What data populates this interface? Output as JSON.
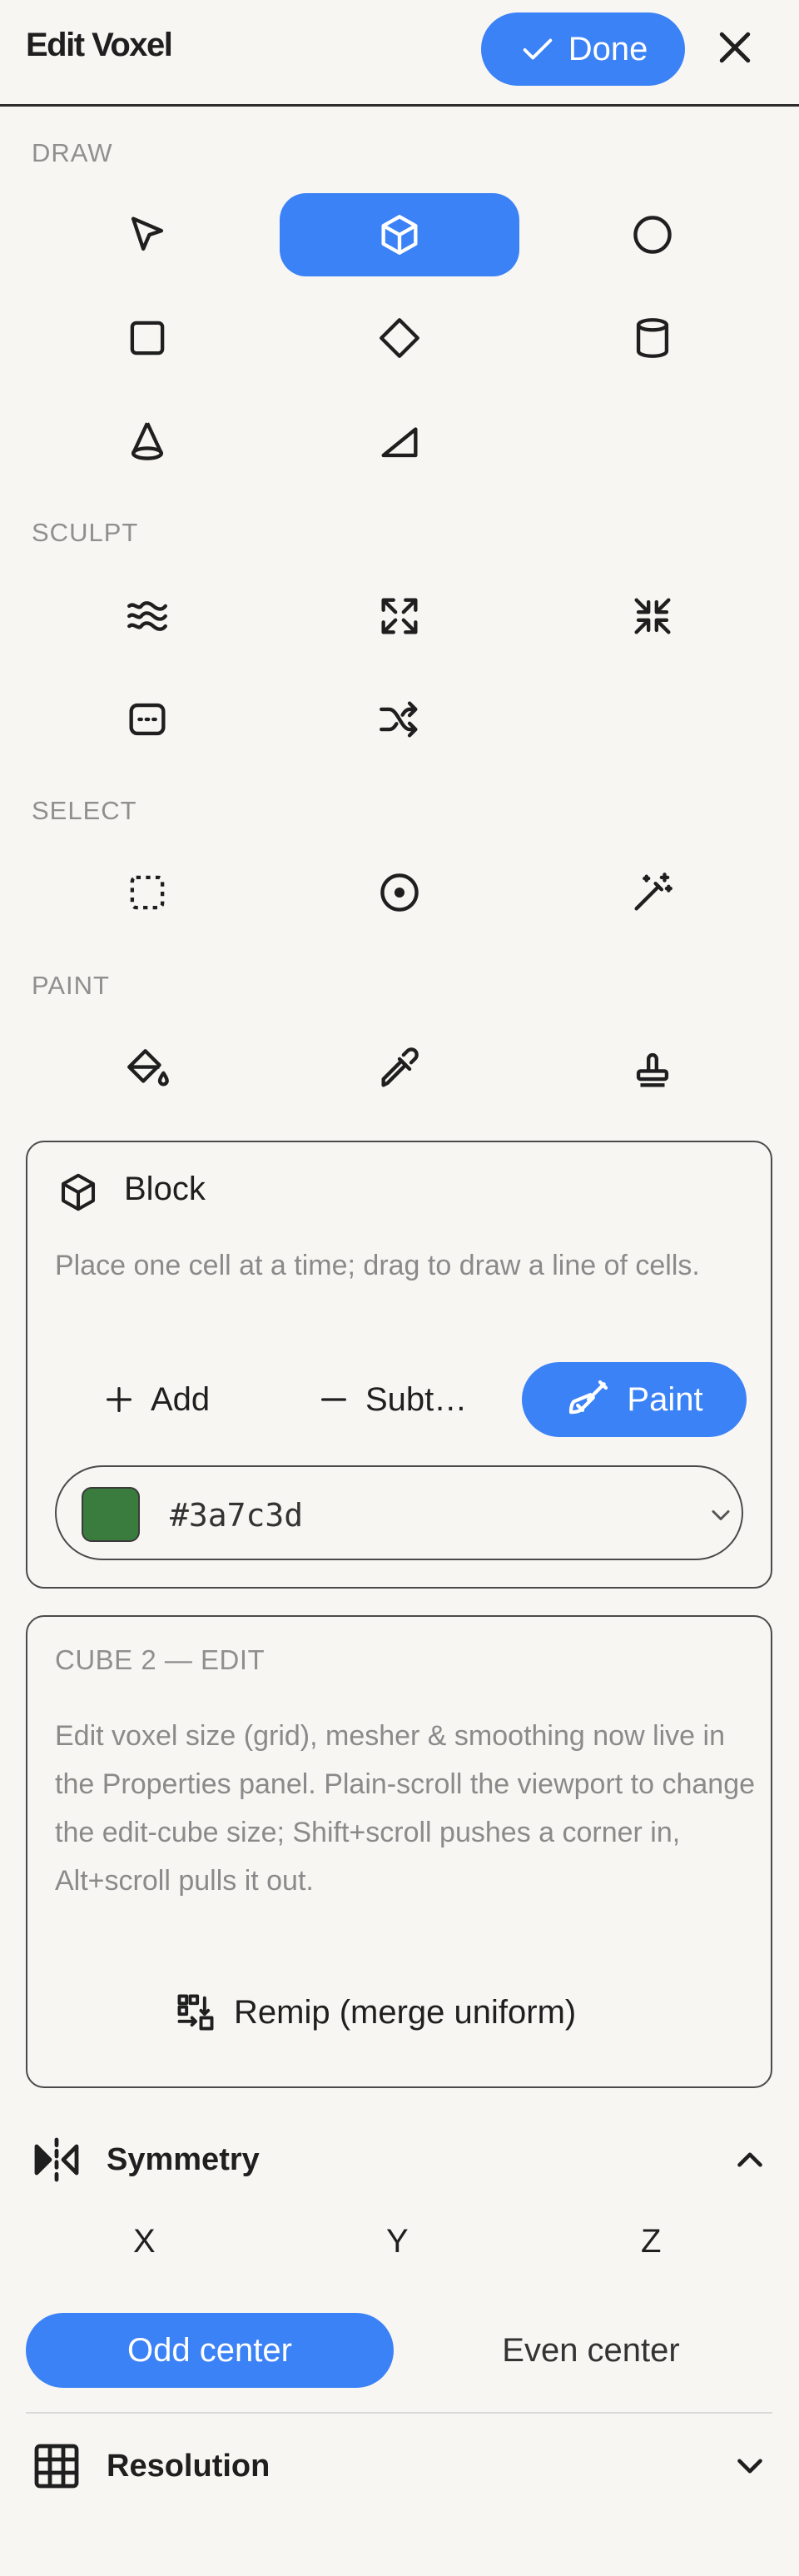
{
  "header": {
    "title": "Edit Voxel",
    "done_label": "Done"
  },
  "sections": {
    "draw": "DRAW",
    "sculpt": "SCULPT",
    "select": "SELECT",
    "paint": "PAINT"
  },
  "tools": {
    "draw": [
      "pointer-icon",
      "cube-icon",
      "sphere-icon",
      "box-icon",
      "diamond-icon",
      "cylinder-icon",
      "cone-icon",
      "wedge-icon"
    ],
    "active_draw_tool": "cube-icon",
    "sculpt": [
      "smooth-icon",
      "expand-icon",
      "shrink-icon",
      "flatten-icon",
      "shuffle-icon"
    ],
    "select": [
      "marquee-select-icon",
      "circle-select-icon",
      "magic-wand-icon"
    ],
    "paint": [
      "paint-bucket-icon",
      "eyedropper-icon",
      "stamp-icon"
    ]
  },
  "block": {
    "title": "Block",
    "description": "Place one cell at a time; drag to draw a line of cells.",
    "modes": {
      "add": "Add",
      "subtract": "Subt…",
      "paint": "Paint"
    },
    "active_mode": "paint",
    "color_value": "#3a7c3d"
  },
  "cube_edit": {
    "label": "CUBE 2 — EDIT",
    "description": "Edit voxel size (grid), mesher & smoothing now live in the Properties panel. Plain-scroll the viewport to change the edit-cube size; Shift+scroll pushes a corner in, Alt+scroll pulls it out.",
    "remip_label": "Remip (merge uniform)"
  },
  "symmetry": {
    "title": "Symmetry",
    "axes": [
      "X",
      "Y",
      "Z"
    ],
    "odd_center": "Odd center",
    "even_center": "Even center",
    "selected_center": "odd"
  },
  "resolution": {
    "title": "Resolution"
  },
  "colors": {
    "accent": "#3b82f6",
    "swatch": "#3a7c3d",
    "muted_text": "#8a8a8a"
  }
}
